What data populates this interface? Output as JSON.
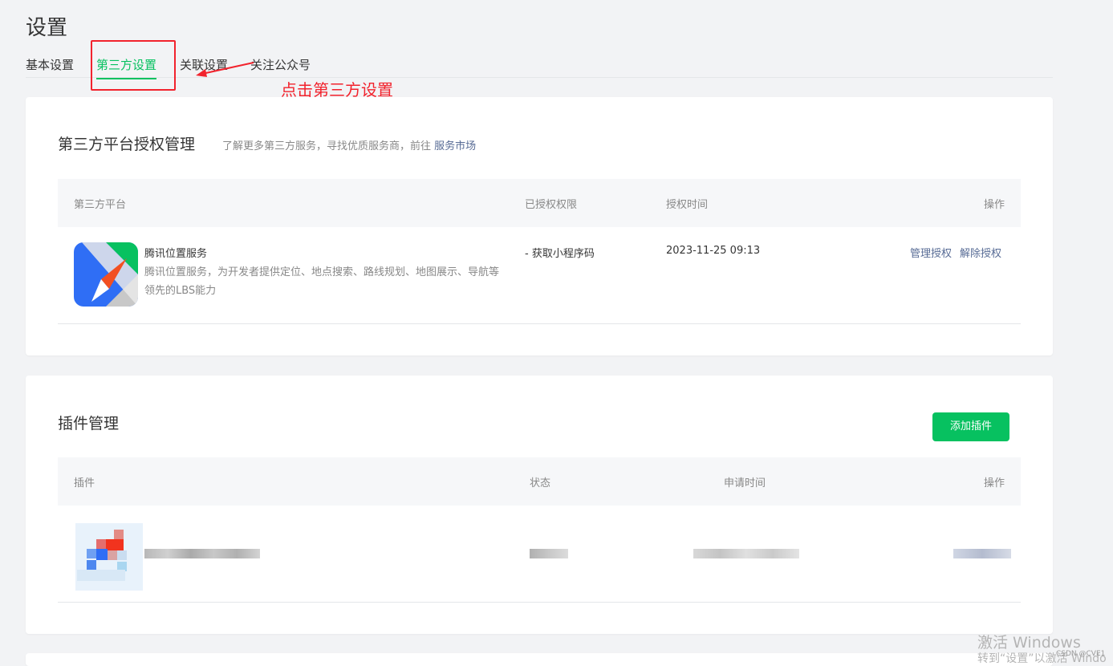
{
  "page": {
    "title": "设置"
  },
  "tabs": [
    {
      "label": "基本设置"
    },
    {
      "label": "第三方设置"
    },
    {
      "label": "关联设置"
    },
    {
      "label": "关注公众号"
    }
  ],
  "annotation": {
    "text": "点击第三方设置",
    "color": "#f2232d"
  },
  "third_party": {
    "title": "第三方平台授权管理",
    "subtitle": "了解更多第三方服务，寻找优质服务商，前往",
    "market_link": "服务市场",
    "columns": [
      "第三方平台",
      "已授权权限",
      "授权时间",
      "操作"
    ],
    "rows": [
      {
        "name": "腾讯位置服务",
        "description": "腾讯位置服务，为开发者提供定位、地点搜索、路线规划、地图展示、导航等领先的LBS能力",
        "permission": "- 获取小程序码",
        "time": "2023-11-25 09:13",
        "action_manage": "管理授权",
        "action_revoke": "解除授权",
        "icon": "tencent-location-icon"
      }
    ]
  },
  "plugins": {
    "title": "插件管理",
    "add_button": "添加插件",
    "columns": [
      "插件",
      "状态",
      "申请时间",
      "操作"
    ]
  },
  "watermark": {
    "line1": "激活 Windows",
    "line2": "转到“设置”以激活 Windo",
    "csdn": "CSDN @CVE1"
  },
  "colors": {
    "accent": "#07c160",
    "link": "#576b95",
    "highlight": "#f2232d"
  }
}
